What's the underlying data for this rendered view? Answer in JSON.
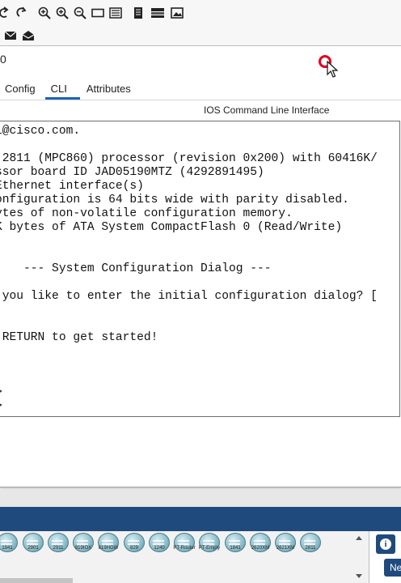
{
  "toolbar": {
    "icons": [
      "undo-icon",
      "redo-icon",
      "zoom-in-icon",
      "zoom-in-alt-icon",
      "zoom-out-icon",
      "rectangle-icon",
      "palette-icon",
      "document-icon",
      "device-stack-icon",
      "image-icon"
    ]
  },
  "toolbar2": {
    "icons": [
      "mail-icon",
      "open-mail-icon"
    ]
  },
  "window": {
    "title": "0",
    "tabs": [
      {
        "label": "Config",
        "active": false
      },
      {
        "label": "CLI",
        "active": true
      },
      {
        "label": "Attributes",
        "active": false
      }
    ],
    "section_title": "IOS Command Line Interface",
    "accent_color": "#1e63b6",
    "cursor_ring_color": "#e0001b"
  },
  "console": {
    "lines": [
      "l@cisco.com.",
      "",
      " 2811 (MPC860) processor (revision 0x200) with 60416K/",
      "ssor board ID JAD05190MTZ (4292891495)",
      "Ethernet interface(s)",
      "onfiguration is 64 bits wide with parity disabled.",
      "ytes of non-volatile configuration memory.",
      "K bytes of ATA System CompactFlash 0 (Read/Write)",
      "",
      "",
      "    --- System Configuration Dialog ---",
      "",
      " you like to enter the initial configuration dialog? [",
      "",
      "",
      " RETURN to get started!",
      "",
      "",
      "",
      ">",
      ">"
    ]
  },
  "devices": [
    {
      "label": "1941"
    },
    {
      "label": "2901"
    },
    {
      "label": "2911"
    },
    {
      "label": "819IOX"
    },
    {
      "label": "819HGW"
    },
    {
      "label": "829"
    },
    {
      "label": "1240"
    },
    {
      "label": "PT-Router"
    },
    {
      "label": "PT-Empty"
    },
    {
      "label": "1841"
    },
    {
      "label": "2620XM"
    },
    {
      "label": "2621XM"
    },
    {
      "label": "2811"
    }
  ],
  "side_panel": {
    "info_label": "i",
    "next_label": "Ne"
  },
  "colors": {
    "device_bar": "#1f4a7e",
    "console_border": "#6f6f6f"
  }
}
